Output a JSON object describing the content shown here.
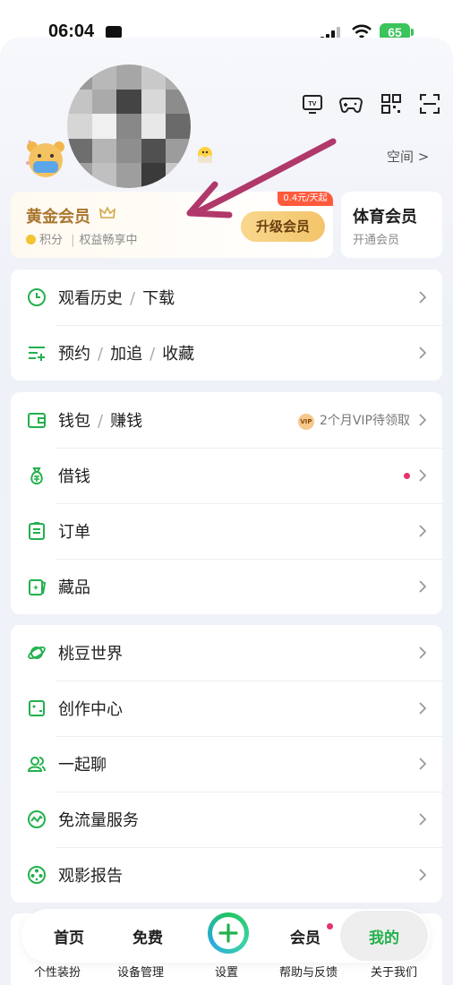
{
  "status_bar": {
    "time": "06:04",
    "battery": "65"
  },
  "header": {
    "icons": [
      "tv-icon",
      "gamepad-icon",
      "qr-code-icon",
      "scan-icon"
    ],
    "tv_text": "TV",
    "space_link": "空间 >"
  },
  "membership": {
    "gold_title": "黄金会员",
    "gold_sub_points": "积分",
    "gold_sub_divider": "|",
    "gold_sub_benefit": "权益畅享中",
    "upgrade_label": "升级会员",
    "price_tag": "0.4元/天起",
    "sports_title": "体育会员",
    "sports_sub": "开通会员"
  },
  "group1": {
    "row1": {
      "a": "观看历史",
      "b": "下载"
    },
    "row2": {
      "a": "预约",
      "b": "加追",
      "c": "收藏"
    }
  },
  "group2": {
    "wallet": {
      "a": "钱包",
      "b": "赚钱",
      "hint": "2个月VIP待领取",
      "vip": "VIP"
    },
    "borrow": "借钱",
    "orders": "订单",
    "collectibles": "藏品"
  },
  "group3": {
    "items": [
      "桃豆世界",
      "创作中心",
      "一起聊",
      "免流量服务",
      "观影报告"
    ]
  },
  "bottom_nav": {
    "home": "首页",
    "free": "免费",
    "member": "会员",
    "mine": "我的"
  },
  "under_labels": [
    "个性装扮",
    "设备管理",
    "设置",
    "帮助与反馈",
    "关于我们"
  ],
  "colors": {
    "accent_green": "#22b14c",
    "gold_text": "#a9762f",
    "annotation_arrow": "#b0386a",
    "red_dot": "#e6336a"
  }
}
